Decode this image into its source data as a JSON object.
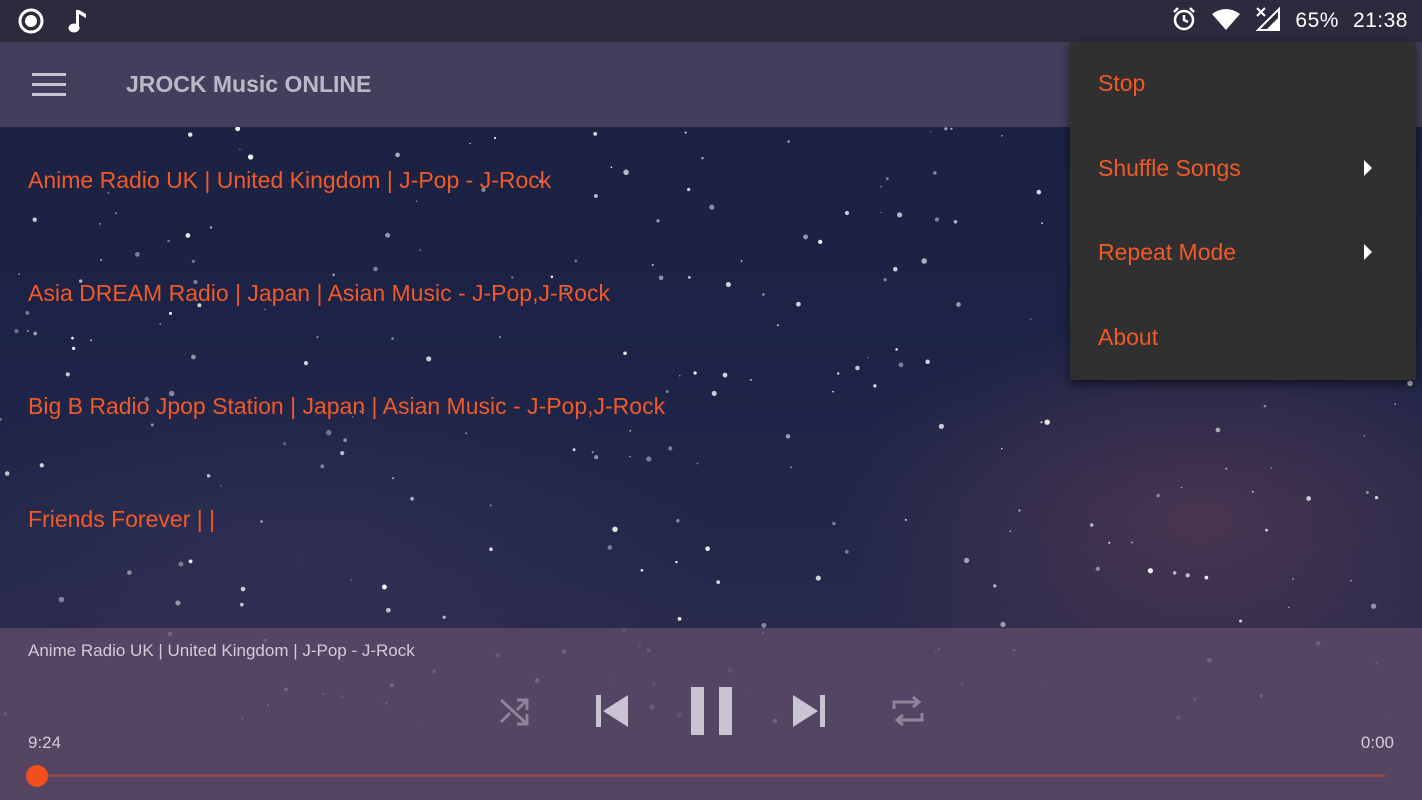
{
  "status_bar": {
    "battery": "65%",
    "time": "21:38",
    "icons": [
      "radio-icon",
      "music-note-icon",
      "alarm-icon",
      "wifi-icon",
      "no-signal-icon"
    ]
  },
  "app_bar": {
    "title": "JROCK Music ONLINE",
    "menu_icon": "hamburger-icon"
  },
  "stations": [
    {
      "label": "Anime Radio UK | United Kingdom | J-Pop - J-Rock"
    },
    {
      "label": "Asia DREAM Radio | Japan | Asian Music - J-Pop,J-Rock"
    },
    {
      "label": "Big B Radio Jpop Station | Japan | Asian Music - J-Pop,J-Rock"
    },
    {
      "label": "Friends Forever | |"
    }
  ],
  "overflow_menu": {
    "items": [
      {
        "label": "Stop",
        "has_submenu": false
      },
      {
        "label": "Shuffle Songs",
        "has_submenu": true
      },
      {
        "label": "Repeat Mode",
        "has_submenu": true
      },
      {
        "label": "About",
        "has_submenu": false
      }
    ]
  },
  "player": {
    "now_playing": "Anime Radio UK | United Kingdom | J-Pop - J-Rock",
    "elapsed": "9:24",
    "duration": "0:00",
    "progress": 0.0,
    "controls": [
      "shuffle-icon",
      "previous-icon",
      "pause-icon",
      "next-icon",
      "repeat-icon"
    ]
  },
  "colors": {
    "accent": "#f05a28",
    "status_bar": "#2c2a3d",
    "app_bar": "#443d5b",
    "menu_bg": "#303030",
    "player_bg": "#5c4a68"
  }
}
